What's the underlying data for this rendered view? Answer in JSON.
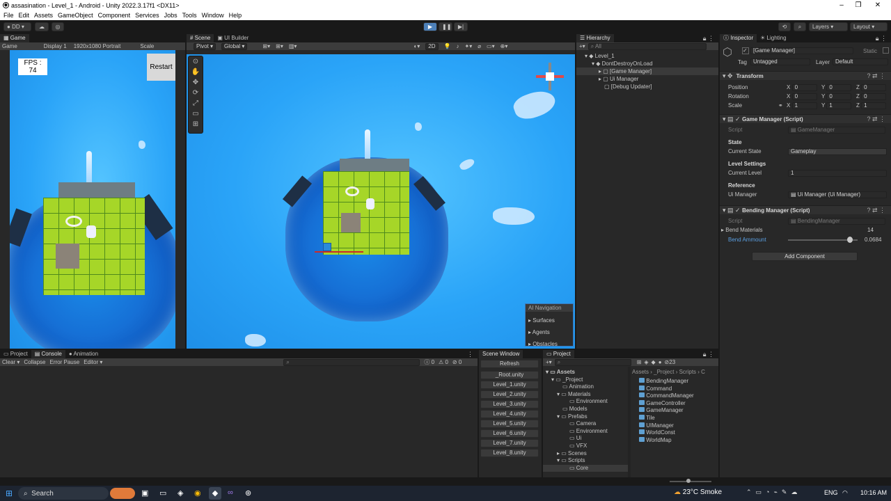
{
  "window": {
    "title": "assasination - Level_1 - Android - Unity 2022.3.17f1 <DX11>",
    "min": "–",
    "max": "❐",
    "close": "✕"
  },
  "menu": [
    "File",
    "Edit",
    "Assets",
    "GameObject",
    "Component",
    "Services",
    "Jobs",
    "Tools",
    "Window",
    "Help"
  ],
  "toolbar": {
    "account": "DD",
    "layers": "Layers",
    "layout": "Layout"
  },
  "game": {
    "tab": "Game",
    "mode": "Game",
    "display": "Display 1",
    "resolution": "1920x1080 Portrait",
    "scale": "Scale",
    "fps_label": "FPS :",
    "fps_value": "74",
    "restart": "Restart"
  },
  "scene": {
    "tab_scene": "Scene",
    "tab_uibuilder": "UI Builder",
    "pivot": "Pivot",
    "global": "Global",
    "mode2d": "2D",
    "overlay_title": "AI Navigation",
    "overlay_items": [
      "Surfaces",
      "Agents",
      "Obstacles"
    ]
  },
  "hierarchy": {
    "tab": "Hierarchy",
    "search_placeholder": "All",
    "items": [
      {
        "label": "Level_1",
        "indent": 0
      },
      {
        "label": "DontDestroyOnLoad",
        "indent": 1
      },
      {
        "label": "[Game Manager]",
        "indent": 2
      },
      {
        "label": "Ui Manager",
        "indent": 2
      },
      {
        "label": "[Debug Updater]",
        "indent": 2
      }
    ]
  },
  "inspector": {
    "tab": "Inspector",
    "tab_lighting": "Lighting",
    "object_name": "[Game Manager]",
    "static": "Static",
    "tag_label": "Tag",
    "tag_value": "Untagged",
    "layer_label": "Layer",
    "layer_value": "Default",
    "transform": {
      "title": "Transform",
      "rows": [
        {
          "label": "Position",
          "x": "0",
          "y": "0",
          "z": "0"
        },
        {
          "label": "Rotation",
          "x": "0",
          "y": "0",
          "z": "0"
        },
        {
          "label": "Scale",
          "x": "1",
          "y": "1",
          "z": "1"
        }
      ]
    },
    "game_manager": {
      "title": "Game Manager (Script)",
      "script_label": "Script",
      "script_value": "GameManager",
      "state_header": "State",
      "current_state_label": "Current State",
      "current_state_value": "Gameplay",
      "level_header": "Level Settings",
      "current_level_label": "Current Level",
      "current_level_value": "1",
      "reference_header": "Reference",
      "ui_manager_label": "Ui Manager",
      "ui_manager_value": "Ui Manager (Ui Manager)"
    },
    "bending_manager": {
      "title": "Bending Manager (Script)",
      "script_label": "Script",
      "script_value": "BendingManager",
      "bend_materials_label": "Bend Materials",
      "bend_materials_count": "14",
      "bend_amount_label": "Bend Ammount",
      "bend_amount_value": "0.0684",
      "bend_amount_fraction": 0.92
    },
    "add_component": "Add Component"
  },
  "console": {
    "tab_project": "Project",
    "tab_console": "Console",
    "tab_animation": "Animation",
    "clear": "Clear",
    "collapse": "Collapse",
    "error_pause": "Error Pause",
    "editor": "Editor",
    "count_info": "0",
    "count_warn": "0",
    "count_err": "0"
  },
  "scene_window": {
    "tab": "Scene Window",
    "refresh": "Refresh",
    "scenes": [
      "_Root.unity",
      "Level_1.unity",
      "Level_2.unity",
      "Level_3.unity",
      "Level_4.unity",
      "Level_5.unity",
      "Level_6.unity",
      "Level_7.unity",
      "Level_8.unity"
    ]
  },
  "project": {
    "tab": "Project",
    "hidden_count": "23",
    "breadcrumb": [
      "Assets",
      "_Project",
      "Scripts",
      "C"
    ],
    "tree": [
      {
        "label": "Assets",
        "indent": 0,
        "bold": true
      },
      {
        "label": "_Project",
        "indent": 1
      },
      {
        "label": "Animation",
        "indent": 2
      },
      {
        "label": "Materials",
        "indent": 2
      },
      {
        "label": "Environment",
        "indent": 3
      },
      {
        "label": "Models",
        "indent": 2
      },
      {
        "label": "Prefabs",
        "indent": 2
      },
      {
        "label": "Camera",
        "indent": 3
      },
      {
        "label": "Environment",
        "indent": 3
      },
      {
        "label": "Ui",
        "indent": 3
      },
      {
        "label": "VFX",
        "indent": 3
      },
      {
        "label": "Scenes",
        "indent": 2
      },
      {
        "label": "Scripts",
        "indent": 2
      },
      {
        "label": "Core",
        "indent": 3
      }
    ],
    "files": [
      "BendingManager",
      "Command",
      "CommandManager",
      "GameController",
      "GameManager",
      "Tile",
      "UIManager",
      "WorldConst",
      "WorldMap"
    ]
  },
  "taskbar": {
    "search": "Search",
    "weather": "23°C  Smoke",
    "lang": "ENG",
    "time": "10:16 AM"
  },
  "colors": {
    "accent": "#3a79bb",
    "file_icon": "#5fa0d2",
    "folder": "#c8c8c8",
    "play_active": "#4d80b8"
  }
}
